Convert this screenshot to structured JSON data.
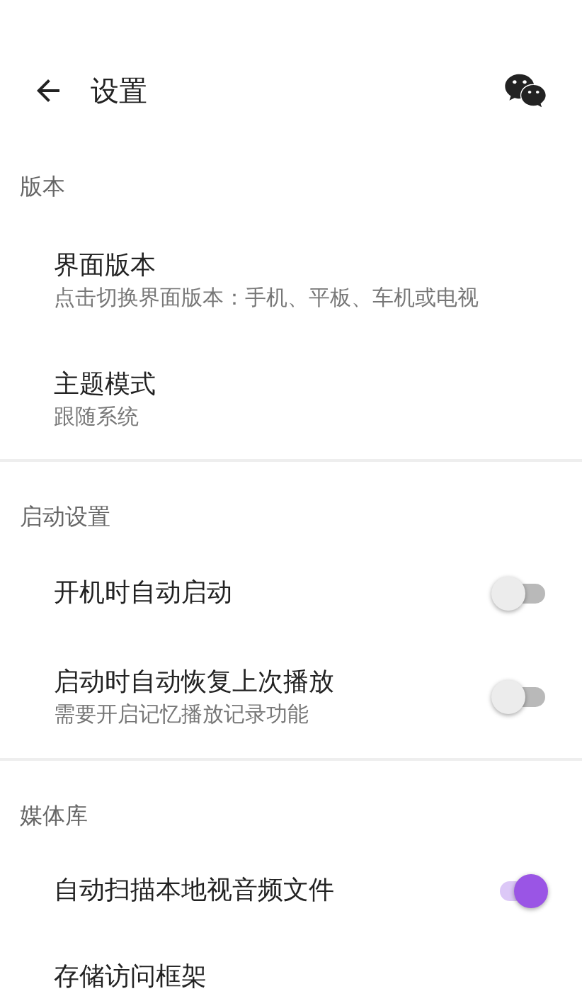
{
  "header": {
    "title": "设置"
  },
  "sections": [
    {
      "label": "版本",
      "items": [
        {
          "kind": "text",
          "title": "界面版本",
          "subtitle": "点击切换界面版本：手机、平板、车机或电视"
        },
        {
          "kind": "text",
          "title": "主题模式",
          "subtitle": "跟随系统"
        }
      ]
    },
    {
      "label": "启动设置",
      "items": [
        {
          "kind": "switch",
          "title": "开机时自动启动",
          "on": false
        },
        {
          "kind": "switch",
          "title": "启动时自动恢复上次播放",
          "subtitle": "需要开启记忆播放记录功能",
          "on": false
        }
      ]
    },
    {
      "label": "媒体库",
      "items": [
        {
          "kind": "switch",
          "title": "自动扫描本地视音频文件",
          "on": true
        },
        {
          "kind": "text",
          "title": "存储访问框架"
        }
      ]
    }
  ]
}
